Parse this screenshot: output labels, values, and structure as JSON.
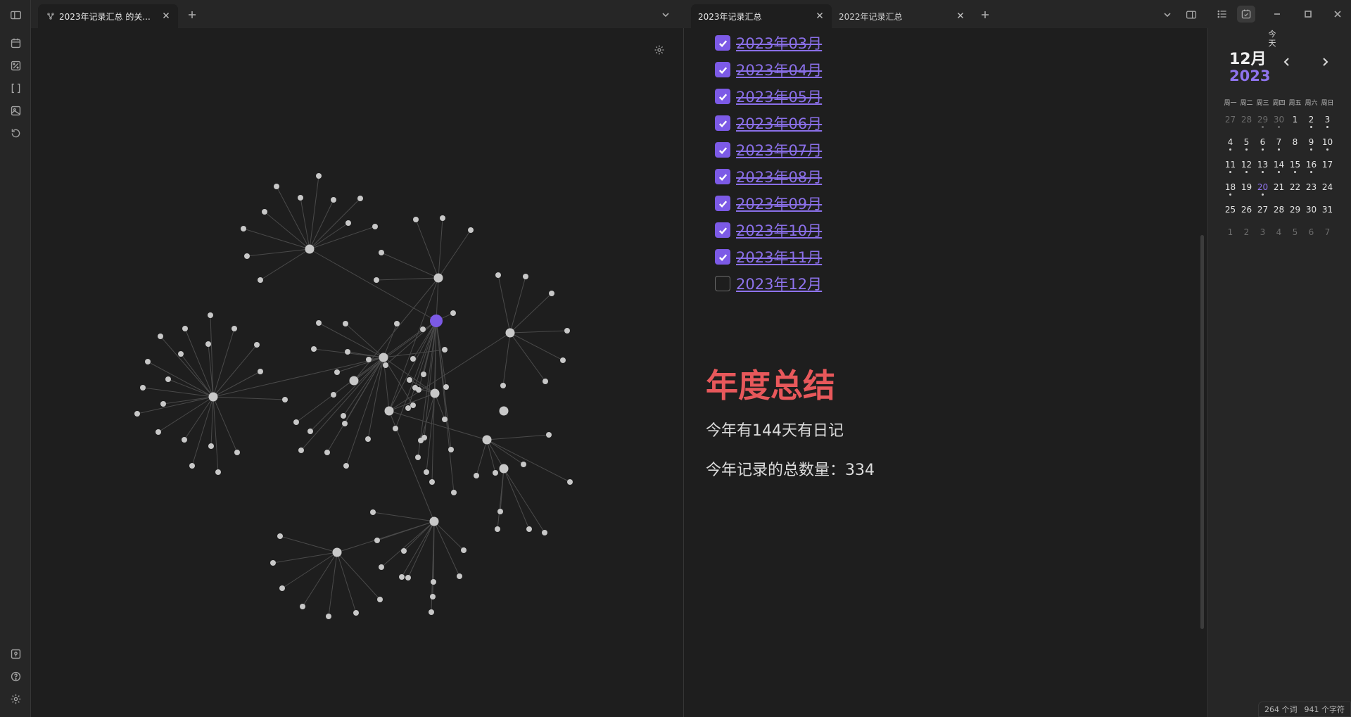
{
  "left_tabs": [
    {
      "label": "2023年记录汇总 的关...",
      "active": true,
      "icon": "graph-icon"
    }
  ],
  "right_tabs": [
    {
      "label": "2023年记录汇总",
      "active": true
    },
    {
      "label": "2022年记录汇总",
      "active": false
    }
  ],
  "ribbon_top": [
    "calendar-icon",
    "canvas-icon",
    "brackets-icon",
    "image-icon",
    "history-icon"
  ],
  "ribbon_bottom": [
    "vault-icon",
    "help-icon",
    "settings-icon"
  ],
  "tasks": [
    {
      "label": "2023年03月",
      "done": true
    },
    {
      "label": "2023年04月",
      "done": true
    },
    {
      "label": "2023年05月",
      "done": true
    },
    {
      "label": "2023年06月",
      "done": true
    },
    {
      "label": "2023年07月",
      "done": true
    },
    {
      "label": "2023年08月",
      "done": true
    },
    {
      "label": "2023年09月",
      "done": true
    },
    {
      "label": "2023年10月",
      "done": true
    },
    {
      "label": "2023年11月",
      "done": true
    },
    {
      "label": "2023年12月",
      "done": false
    }
  ],
  "note": {
    "heading": "年度总结",
    "line1": "今年有144天有日记",
    "line2": "今年记录的总数量：334",
    "heading_color": "#e8585b"
  },
  "calendar": {
    "month": "12月",
    "year": "2023",
    "today_label": "今天",
    "weekdays": [
      "周一",
      "周二",
      "周三",
      "周四",
      "周五",
      "周六",
      "周日"
    ],
    "weeks": [
      [
        {
          "d": "27",
          "dim": true
        },
        {
          "d": "28",
          "dim": true
        },
        {
          "d": "29",
          "dim": true,
          "dot": true
        },
        {
          "d": "30",
          "dim": true,
          "dot": true
        },
        {
          "d": "1"
        },
        {
          "d": "2",
          "dot": true
        },
        {
          "d": "3",
          "dot": true
        }
      ],
      [
        {
          "d": "4",
          "dot": true
        },
        {
          "d": "5",
          "dot": true
        },
        {
          "d": "6",
          "dot": true
        },
        {
          "d": "7",
          "dot": true
        },
        {
          "d": "8"
        },
        {
          "d": "9",
          "dot": true
        },
        {
          "d": "10",
          "dot": true
        }
      ],
      [
        {
          "d": "11",
          "dot": true
        },
        {
          "d": "12",
          "dot": true
        },
        {
          "d": "13",
          "dot": true
        },
        {
          "d": "14",
          "dot": true
        },
        {
          "d": "15",
          "dot": true
        },
        {
          "d": "16",
          "dot": true
        },
        {
          "d": "17"
        }
      ],
      [
        {
          "d": "18",
          "dot": true
        },
        {
          "d": "19"
        },
        {
          "d": "20",
          "today": true,
          "dot": true
        },
        {
          "d": "21"
        },
        {
          "d": "22"
        },
        {
          "d": "23"
        },
        {
          "d": "24"
        }
      ],
      [
        {
          "d": "25"
        },
        {
          "d": "26"
        },
        {
          "d": "27"
        },
        {
          "d": "28"
        },
        {
          "d": "29"
        },
        {
          "d": "30"
        },
        {
          "d": "31"
        }
      ],
      [
        {
          "d": "1",
          "dim": true
        },
        {
          "d": "2",
          "dim": true
        },
        {
          "d": "3",
          "dim": true
        },
        {
          "d": "4",
          "dim": true
        },
        {
          "d": "5",
          "dim": true
        },
        {
          "d": "6",
          "dim": true
        },
        {
          "d": "7",
          "dim": true
        }
      ]
    ]
  },
  "status": {
    "words": "264 个词",
    "chars": "941 个字符"
  },
  "colors": {
    "accent": "#8f74ee",
    "active_node": "#7c5ae6",
    "node": "#c8c8c8",
    "link": "#4a4a4a"
  }
}
